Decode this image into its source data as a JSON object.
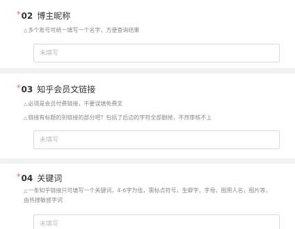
{
  "questions": [
    {
      "number": "02",
      "label": "博主昵称",
      "required_mark": "*",
      "hints": [
        "多个账号可统一填写一个名字，方便查询结果"
      ],
      "input": {
        "value": "",
        "placeholder": "未填写"
      }
    },
    {
      "number": "03",
      "label": "知乎会员文链接",
      "required_mark": "*",
      "hints": [
        "必须是会员付费链接，不要误填免费文",
        "链接有标题的到链接的部分吧？包括了后边的字符全部删掉，不然审核不上"
      ],
      "input": {
        "value": "",
        "placeholder": "未填写"
      }
    },
    {
      "number": "04",
      "label": "关键词",
      "required_mark": "*",
      "hints": [
        "一条知乎链接只可填写一个关键词，4-6字为佳，需标点符号，生僻字，字母，图用人名，图片等，由热搜敏感字词"
      ],
      "input": {
        "value": "",
        "placeholder": "未填写"
      }
    }
  ],
  "icons": {
    "hint": "warning-triangle-icon"
  },
  "colors": {
    "required_star": "#e85a5a",
    "background": "#f2f2f2",
    "card": "#ffffff"
  }
}
